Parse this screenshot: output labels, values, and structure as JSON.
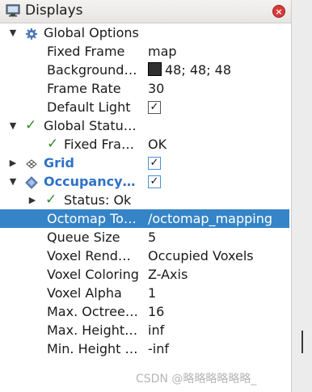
{
  "panel": {
    "title": "Displays",
    "close_label": "×"
  },
  "rows": [
    {
      "name": "Global Options",
      "value": ""
    },
    {
      "name": "Fixed Frame",
      "value": "map"
    },
    {
      "name": "Background…",
      "value": "48; 48; 48"
    },
    {
      "name": "Frame Rate",
      "value": "30"
    },
    {
      "name": "Default Light",
      "value": ""
    },
    {
      "name": "Global Statu…",
      "value": ""
    },
    {
      "name": "Fixed Fra…",
      "value": "OK"
    },
    {
      "name": "Grid",
      "value": ""
    },
    {
      "name": "Occupancy…",
      "value": ""
    },
    {
      "name": "Status: Ok",
      "value": ""
    },
    {
      "name": "Octomap To…",
      "value": "/octomap_mapping"
    },
    {
      "name": "Queue Size",
      "value": "5"
    },
    {
      "name": "Voxel Rend…",
      "value": "Occupied Voxels"
    },
    {
      "name": "Voxel Coloring",
      "value": "Z-Axis"
    },
    {
      "name": "Voxel Alpha",
      "value": "1"
    },
    {
      "name": "Max. Octree…",
      "value": "16"
    },
    {
      "name": "Max. Height…",
      "value": "inf"
    },
    {
      "name": "Min. Height …",
      "value": "-inf"
    }
  ],
  "checkbox_glyph": "✓",
  "watermark": "CSDN @略略略略略略_",
  "colors": {
    "selection": "#3584c7",
    "link": "#2e72c7",
    "ok_check": "#2e8b2e",
    "background_swatch": "#303030"
  }
}
